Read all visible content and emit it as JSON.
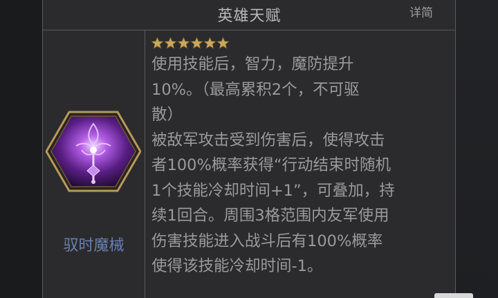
{
  "header": {
    "title": "英雄天赋",
    "detail_toggle": "详简"
  },
  "talent": {
    "name": "驭时魔械",
    "stars": 6,
    "description": [
      "使用技能后，智力，魔防提升",
      "10%。（最高累积2个，不可驱",
      "散）",
      "被敌军攻击受到伤害后，使得攻击",
      "者100%概率获得“行动结束时随机",
      "1个技能冷却时间+1”，可叠加，持",
      "续1回合。周围3格范围内友军使用",
      "伤害技能进入战斗后有100%概率",
      "使得该技能冷却时间-1。"
    ]
  },
  "icons": {
    "star": "star-icon",
    "emblem": "purple-staff-emblem-icon"
  },
  "colors": {
    "panel_bg": "#2b2b2d",
    "title_text": "#b9b9b9",
    "body_text": "#9a9a9a",
    "skill_name": "#6a7fb0",
    "star_gold": "#c9a75c",
    "frame_gold": "#b89a5a",
    "emblem_purple": "#9a3fd6"
  }
}
